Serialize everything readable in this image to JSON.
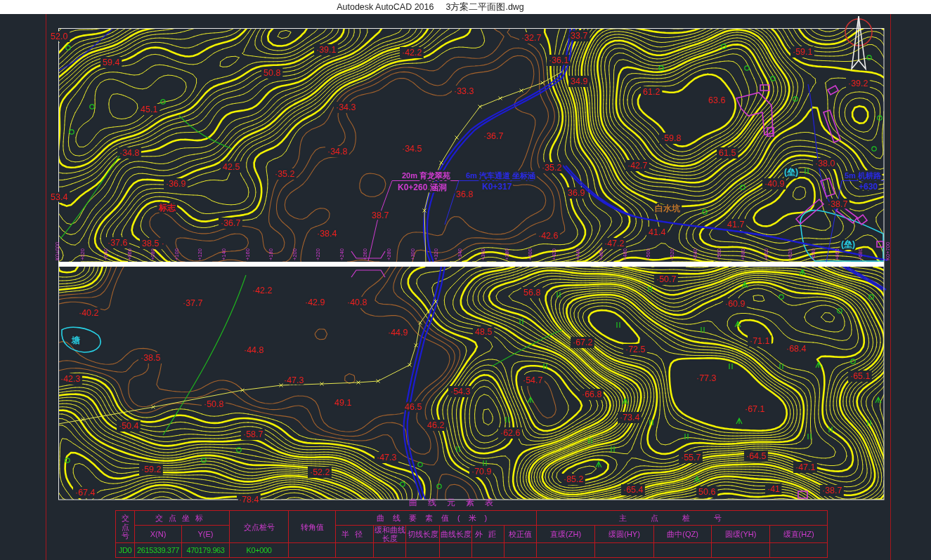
{
  "title_bar": {
    "app": "Autodesk AutoCAD 2016",
    "file": "3方案二平面图.dwg"
  },
  "map": {
    "top_strip": {
      "elevations": [
        "52.0",
        "·32.7",
        "33.7",
        "·39.1",
        "·42.2",
        "·59.1",
        "59.4",
        "·36.1",
        "50.8",
        "34.9",
        "·39.2",
        "·33.3",
        "61.2",
        "63.6",
        "45.1",
        "·34.3",
        "·36.7",
        "·59.8",
        "·34.8",
        "·34.8",
        "·34.5",
        "61.5",
        "42.5",
        "·35.2",
        "·42.7",
        "·38.0",
        "·35.2",
        "·36.9",
        "·40.9",
        "53.4",
        "36.8",
        "36.9",
        "·38.7",
        "38.7",
        "·36.7",
        "41.7",
        "·38.4",
        "·42.6",
        "41.4",
        "·37.6",
        "38.5 ·",
        "·47.2"
      ],
      "stations": [
        "K0+000",
        "+020",
        "+040",
        "+060",
        "+080",
        "+100",
        "+120",
        "+140",
        "+160",
        "+180",
        "+200",
        "+220",
        "+240",
        "+260",
        "+280",
        "+300",
        "+320",
        "+340",
        "+360",
        "+380",
        "+400",
        "+420",
        "+440",
        "+460",
        "+480",
        "+500",
        "+520",
        "+540",
        "+560",
        "+580",
        "+600",
        "+620",
        "+640",
        "+660",
        "+680",
        "K0+700"
      ],
      "annotations": [
        {
          "color": "#d23cd2",
          "lines": [
            "20m 育龙翠苑",
            "K0+260 涵洞"
          ]
        },
        {
          "color": "#2a2ae8",
          "lines": [
            "6m 汽车通道 坐标涵",
            "K0+317"
          ]
        },
        {
          "color": "#2a2ae8",
          "lines": [
            "5m 机耕路",
            "+630"
          ]
        }
      ],
      "place_names": [
        {
          "text": "标志",
          "color": "#e6191e"
        },
        {
          "text": "白水坑",
          "color": "#c87828"
        },
        {
          "text": "(垒)",
          "color": "#28d2e6"
        },
        {
          "text": "(垒)",
          "color": "#28d2e6"
        }
      ]
    },
    "bottom_strip": {
      "elevations": [
        "·50.7",
        "·42.2",
        "56.8",
        "·37.7",
        "·42.9",
        "·40.8",
        "·60.9",
        "·40.2",
        "·44.9",
        "48.5",
        "·67.2",
        "·71.1",
        "·44.8",
        "·72.5",
        "·68.4",
        "·38.5",
        "·42.3",
        "·47.3",
        "·54.7",
        "·77.3",
        "·65.1",
        "·54.3",
        "·66.8",
        "·50.8",
        "49.1",
        "46.5",
        "·67.1",
        "·73.4",
        "·50.4",
        "46.2",
        "·58.7",
        "·62.6",
        "·47.3",
        "·55.7",
        "·64.5",
        "·59.2",
        "·52.2",
        "·70.9",
        "·47.1",
        "·85.2",
        "·67.4",
        "·65.4",
        "50.6",
        "·41",
        "·38.7",
        "·78.4"
      ],
      "place_names": [
        {
          "text": "塘",
          "color": "#28d2e6"
        }
      ]
    }
  },
  "table": {
    "title": "曲线元素表",
    "header_row_1": [
      "交点号",
      "交点坐标",
      "交点桩号",
      "转角值",
      "曲线要素值(米)",
      "主点桩号"
    ],
    "header_row_2": [
      "X(N)",
      "Y(E)",
      "半径",
      "缓和曲线长度",
      "切线长度",
      "曲线长度",
      "外距",
      "校正值",
      "直缓(ZH)",
      "缓圆(HY)",
      "曲中(QZ)",
      "圆缓(YH)",
      "缓直(HZ)"
    ],
    "rows": [
      [
        "JD0",
        "2615339.377",
        "470179.963",
        "K0+000"
      ]
    ]
  }
}
